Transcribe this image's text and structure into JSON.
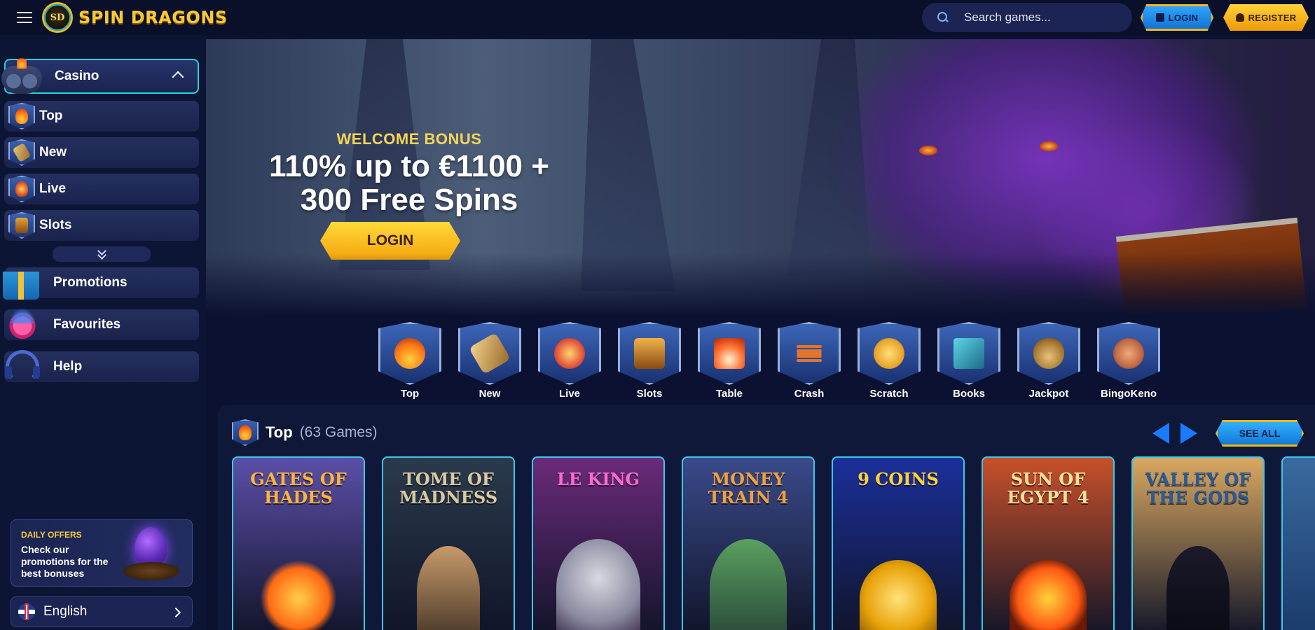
{
  "header": {
    "brand_initials": "SD",
    "brand_name": "SPIN DRAGONS",
    "search_placeholder": "Search games...",
    "login_label": "LOGIN",
    "register_label": "REGISTER"
  },
  "sidebar": {
    "casino_label": "Casino",
    "sub_items": [
      {
        "label": "Top",
        "icon": "flame-icon"
      },
      {
        "label": "New",
        "icon": "scroll-icon"
      },
      {
        "label": "Live",
        "icon": "cards-icon"
      },
      {
        "label": "Slots",
        "icon": "slot-machine-icon"
      }
    ],
    "main_items": [
      {
        "label": "Promotions",
        "icon": "gift-icon"
      },
      {
        "label": "Favourites",
        "icon": "heart-icon"
      },
      {
        "label": "Help",
        "icon": "headset-icon"
      }
    ],
    "daily_offers": {
      "title": "DAILY OFFERS",
      "text": "Check our promotions for the best bonuses"
    },
    "language": "English"
  },
  "hero": {
    "kicker": "WELCOME BONUS",
    "title_line1": "110% up to €1100 +",
    "title_line2": "300 Free Spins",
    "button_label": "LOGIN"
  },
  "categories": [
    {
      "label": "Top",
      "icon": "flame-icon",
      "color": "#ff7a1a"
    },
    {
      "label": "New",
      "icon": "scroll-icon",
      "color": "#d9a441"
    },
    {
      "label": "Live",
      "icon": "cards-icon",
      "color": "#e04d3a"
    },
    {
      "label": "Slots",
      "icon": "slot-machine-icon",
      "color": "#e2a233"
    },
    {
      "label": "Table",
      "icon": "flaming-cards-icon",
      "color": "#ff6a2a"
    },
    {
      "label": "Crash",
      "icon": "plane-icon",
      "color": "#e3742f"
    },
    {
      "label": "Scratch",
      "icon": "coin-card-icon",
      "color": "#f0b93a"
    },
    {
      "label": "Books",
      "icon": "book-icon",
      "color": "#3fb6c9"
    },
    {
      "label": "Jackpot",
      "icon": "money-bag-icon",
      "color": "#d7a548"
    },
    {
      "label": "BingoKeno",
      "icon": "bingo-cage-icon",
      "color": "#c26a45"
    }
  ],
  "games_section": {
    "title": "Top",
    "count": "(63 Games)",
    "see_all_label": "SEE ALL",
    "tiles": [
      {
        "name": "GATES OF HADES",
        "bg": "#5b4fa8",
        "fg": "#ffb43a"
      },
      {
        "name": "TOME OF MADNESS",
        "bg": "#2a3a4c",
        "fg": "#d8c9a0"
      },
      {
        "name": "LE KING",
        "bg": "#6a2a7a",
        "fg": "#ff6ad0"
      },
      {
        "name": "MONEY TRAIN 4",
        "bg": "#3a4a8a",
        "fg": "#f0a040"
      },
      {
        "name": "9 COINS",
        "bg": "#1b2f9a",
        "fg": "#ffd23a"
      },
      {
        "name": "SUN OF EGYPT 4",
        "bg": "#c8502a",
        "fg": "#ffe09a"
      },
      {
        "name": "VALLEY OF THE GODS",
        "bg": "#d9a860",
        "fg": "#2a5a9a"
      }
    ]
  }
}
